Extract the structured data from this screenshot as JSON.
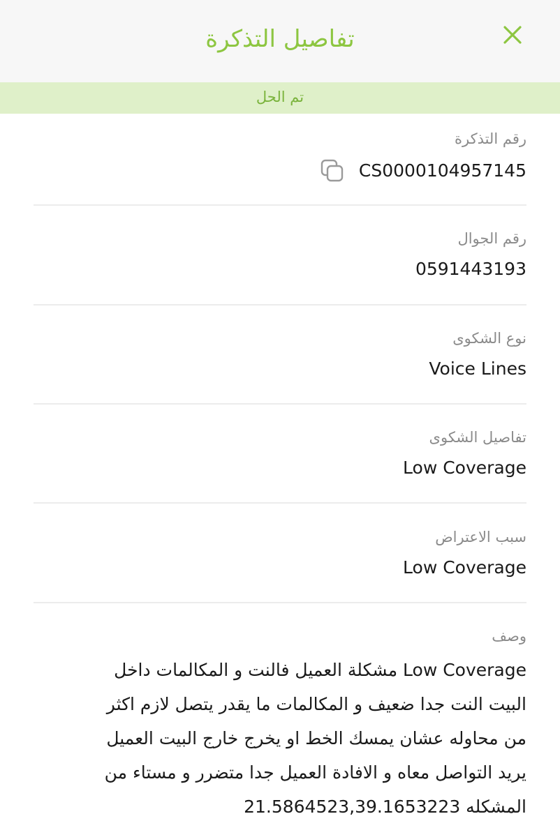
{
  "header": {
    "title": "تفاصيل التذكرة",
    "close_icon": "close-icon"
  },
  "status": {
    "label": "تم الحل"
  },
  "fields": {
    "ticket_number": {
      "label": "رقم التذكرة",
      "value": "CS0000104957145",
      "copy_icon": "copy-icon"
    },
    "mobile_number": {
      "label": "رقم الجوال",
      "value": "0591443193"
    },
    "complaint_type": {
      "label": "نوع الشكوى",
      "value": "Voice Lines"
    },
    "complaint_details": {
      "label": "تفاصيل الشكوى",
      "value": "Low Coverage"
    },
    "objection_reason": {
      "label": "سبب الاعتراض",
      "value": "Low Coverage"
    },
    "description": {
      "label": "وصف",
      "value": "Low Coverage مشكلة العميل فالنت و المكالمات داخل البيت النت جدا ضعيف و المكالمات ما يقدر يتصل لازم اكثر من محاوله عشان يمسك الخط او يخرج خارج البيت العميل يريد التواصل معاه و الافادة العميل جدا متضرر و مستاء من المشكله 21.5864523,39.1653223"
    }
  },
  "colors": {
    "accent_green": "#8dc641",
    "status_bg": "#dff0c9",
    "header_bg": "#f7f7f7",
    "label_gray": "#8a8a8a",
    "divider": "#ececec"
  }
}
